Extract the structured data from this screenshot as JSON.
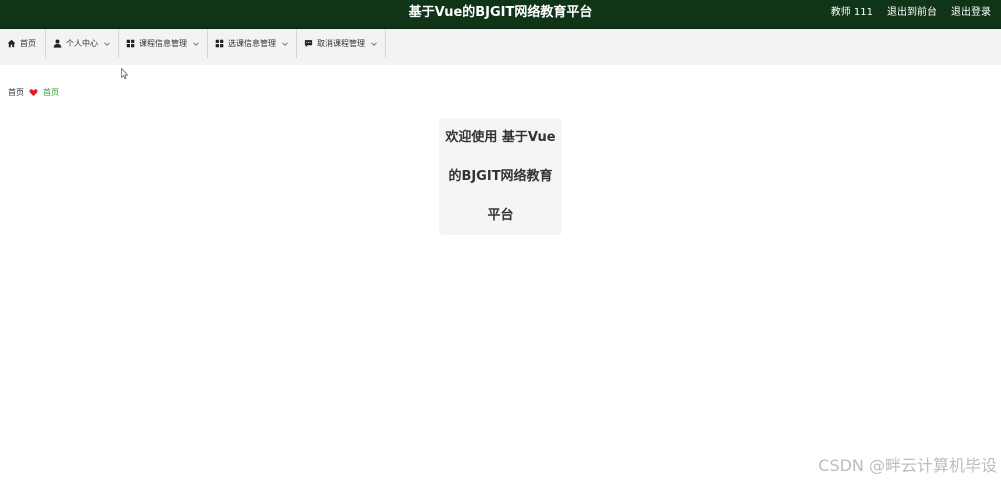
{
  "header": {
    "app_title": "基于Vue的BJGIT网络教育平台",
    "user_label": "教师 111",
    "exit_to_front": "退出到前台",
    "logout": "退出登录",
    "background_color": "#0f3418"
  },
  "menu": {
    "items": [
      {
        "label": "首页",
        "icon": "home-icon",
        "has_dropdown": false
      },
      {
        "label": "个人中心",
        "icon": "user-icon",
        "has_dropdown": true
      },
      {
        "label": "课程信息管理",
        "icon": "grid-icon",
        "has_dropdown": true
      },
      {
        "label": "选课信息管理",
        "icon": "grid-icon",
        "has_dropdown": true
      },
      {
        "label": "取消课程管理",
        "icon": "chat-icon",
        "has_dropdown": true
      }
    ]
  },
  "breadcrumb": {
    "home": "首页",
    "separator_icon": "heart-icon",
    "separator_color": "#e02020",
    "current": "首页",
    "current_color": "#3a9a3a"
  },
  "welcome": {
    "lines": [
      "欢迎使用 基于Vue",
      "的BJGIT网络教育",
      "平台"
    ]
  },
  "watermark": {
    "text": "CSDN @畔云计算机毕设"
  }
}
